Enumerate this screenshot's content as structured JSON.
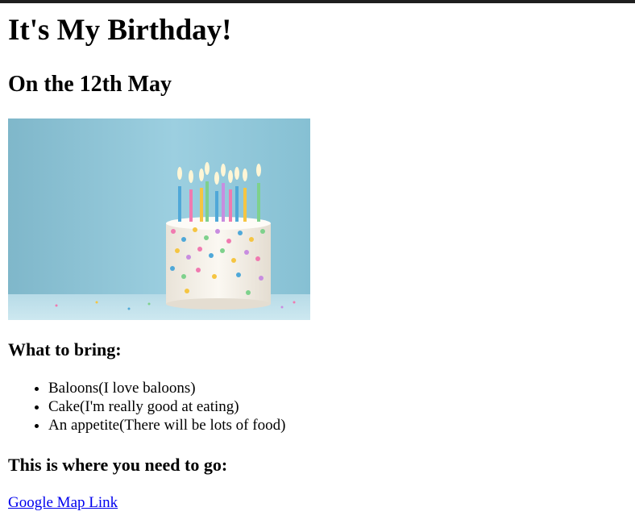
{
  "page": {
    "title": "It's My Birthday!",
    "date_heading": "On the 12th May"
  },
  "image": {
    "alt": "birthday cake with candles and sprinkles",
    "colors": {
      "backdrop": "#8ec3d6",
      "cake": "#f4efe6",
      "table": "#bfe0ea"
    }
  },
  "bring": {
    "heading": "What to bring:",
    "items": [
      "Baloons(I love baloons)",
      "Cake(I'm really good at eating)",
      "An appetite(There will be lots of food)"
    ]
  },
  "directions": {
    "heading": "This is where you need to go:",
    "link_text": "Google Map Link"
  },
  "colors": {
    "link": "#0000ee",
    "top_bar": "#1f1f1f"
  }
}
